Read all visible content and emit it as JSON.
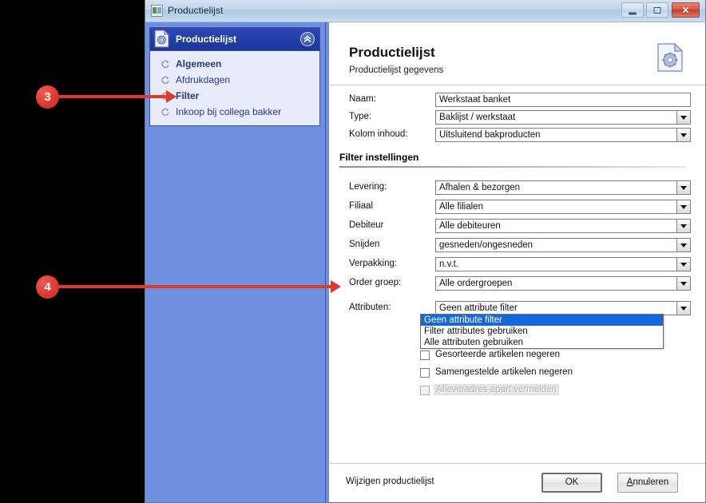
{
  "window": {
    "title": "Productielijst",
    "icon": "window-app-icon",
    "buttons": {
      "minimize": "minimize-icon",
      "maximize": "maximize-icon",
      "close": "✕"
    }
  },
  "sidebar": {
    "header": {
      "label": "Productielijst",
      "icon": "gear-document-icon",
      "collapse_icon": "double-chevron-up-icon"
    },
    "items": [
      {
        "label": "Algemeen",
        "bold": true,
        "icon": "arrow-circle-icon",
        "active": false
      },
      {
        "label": "Afdrukdagen",
        "bold": false,
        "icon": "arrow-circle-icon",
        "active": false
      },
      {
        "label": "Filter",
        "bold": true,
        "icon": "arrow-circle-icon-active",
        "active": true
      },
      {
        "label": "Inkoop bij collega bakker",
        "bold": false,
        "icon": "arrow-circle-icon",
        "active": false
      }
    ]
  },
  "content": {
    "title": "Productielijst",
    "subtitle": "Productielijst gegevens",
    "icon": "gear-document-icon",
    "fields": [
      {
        "label": "Naam:",
        "value": "Werkstaat banket",
        "type": "text"
      },
      {
        "label": "Type:",
        "value": "Baklijst / werkstaat",
        "type": "select"
      },
      {
        "label": "Kolom inhoud:",
        "value": "Uitsluitend bakproducten",
        "type": "select"
      }
    ],
    "group": {
      "title": "Filter instellingen",
      "fields": [
        {
          "label": "Levering:",
          "value": "Afhalen & bezorgen",
          "type": "select"
        },
        {
          "label": "Filiaal",
          "value": "Alle filialen",
          "type": "select"
        },
        {
          "label": "Debiteur",
          "value": "Alle debiteuren",
          "type": "select"
        },
        {
          "label": "Snijden",
          "value": "gesneden/ongesneden",
          "type": "select"
        },
        {
          "label": "Verpakking:",
          "value": "n.v.t.",
          "type": "select"
        },
        {
          "label": "Order groep:",
          "value": "Alle ordergroepen",
          "type": "select"
        },
        {
          "label": "Attributen:",
          "value": "Geen attribute filter",
          "type": "select",
          "open": true
        }
      ],
      "dropdown_options": [
        {
          "label": "Geen attribute filter",
          "selected": true
        },
        {
          "label": "Filter attributes gebruiken",
          "selected": false
        },
        {
          "label": "Alle attributen gebruiken",
          "selected": false
        }
      ],
      "checkboxes": [
        {
          "label": "Gesorteerde artikelen negeren",
          "checked": false,
          "disabled": false
        },
        {
          "label": "Samengestelde artikelen negeren",
          "checked": false,
          "disabled": false
        },
        {
          "label": "Afleveradres apart vermelden",
          "checked": false,
          "disabled": true
        }
      ]
    }
  },
  "footer": {
    "status": "Wijzigen productielijst",
    "ok_label": "OK",
    "cancel_label": "Annuleren",
    "cancel_accel": "A",
    "cancel_rest": "nnuleren"
  },
  "annotations": [
    {
      "number": "3",
      "target": "sidebar-item-filter"
    },
    {
      "number": "4",
      "target": "field-attributen"
    }
  ],
  "colors": {
    "sidebar_blue": "#6f8fe0",
    "nav_header_blue": "#2340a8",
    "annotation_red": "#d93b2e",
    "dropdown_highlight": "#1668d8"
  }
}
